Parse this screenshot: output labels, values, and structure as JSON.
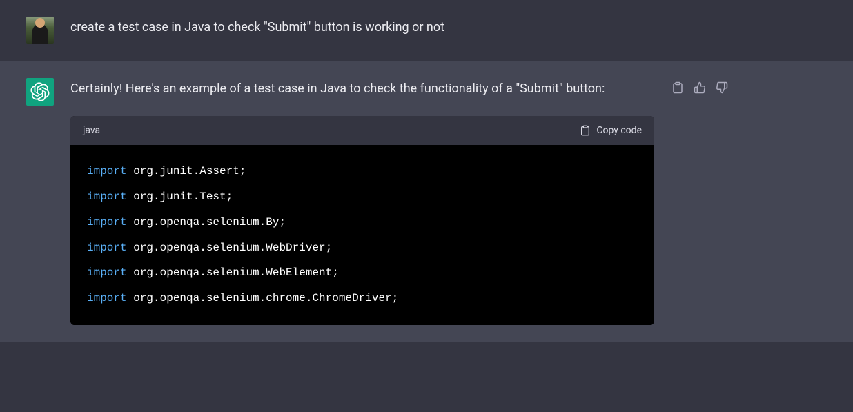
{
  "user_message": {
    "text": "create a test case in Java to check \"Submit\" button is working or not"
  },
  "assistant_message": {
    "intro_text": "Certainly! Here's an example of a test case in Java to check the functionality of a \"Submit\" button:"
  },
  "code_block": {
    "language": "java",
    "copy_label": "Copy code",
    "lines": [
      {
        "keyword": "import",
        "rest": " org.junit.Assert;"
      },
      {
        "keyword": "import",
        "rest": " org.junit.Test;"
      },
      {
        "keyword": "import",
        "rest": " org.openqa.selenium.By;"
      },
      {
        "keyword": "import",
        "rest": " org.openqa.selenium.WebDriver;"
      },
      {
        "keyword": "import",
        "rest": " org.openqa.selenium.WebElement;"
      },
      {
        "keyword": "import",
        "rest": " org.openqa.selenium.chrome.ChromeDriver;"
      }
    ]
  },
  "icons": {
    "clipboard": "clipboard-icon",
    "thumbs_up": "thumbs-up-icon",
    "thumbs_down": "thumbs-down-icon",
    "copy": "copy-icon"
  }
}
